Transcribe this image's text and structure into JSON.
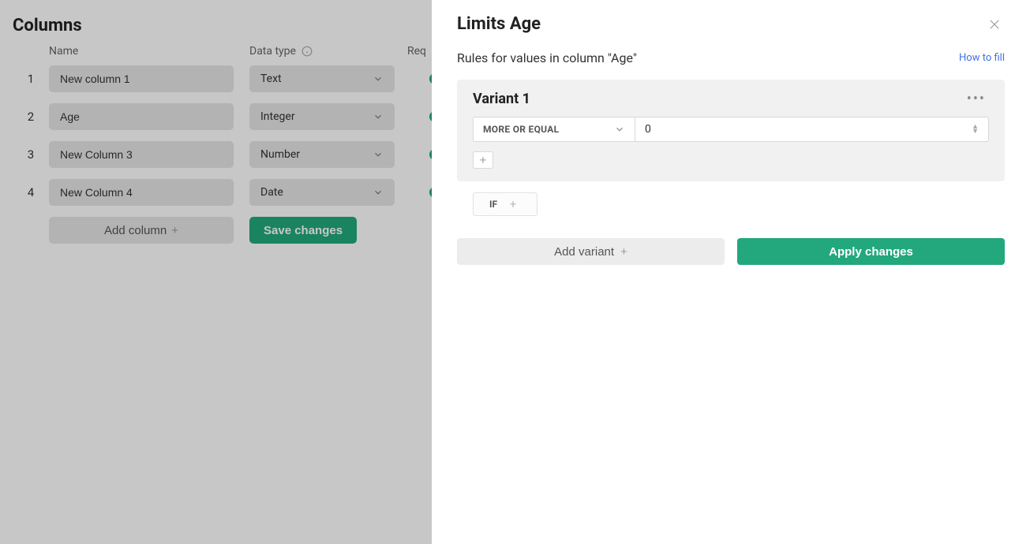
{
  "background": {
    "title": "Columns",
    "headers": {
      "name": "Name",
      "datatype": "Data type",
      "required": "Req"
    },
    "rows": [
      {
        "num": "1",
        "name": "New column 1",
        "type": "Text"
      },
      {
        "num": "2",
        "name": "Age",
        "type": "Integer"
      },
      {
        "num": "3",
        "name": "New Column 3",
        "type": "Number"
      },
      {
        "num": "4",
        "name": "New Column 4",
        "type": "Date"
      }
    ],
    "add_column_label": "Add column",
    "save_changes_label": "Save changes"
  },
  "drawer": {
    "title": "Limits Age",
    "subtitle": "Rules for values in column \"Age\"",
    "how_to_fill": "How to fill",
    "variant": {
      "title": "Variant 1",
      "operator": "MORE OR EQUAL",
      "value": "0",
      "if_label": "IF"
    },
    "add_variant_label": "Add variant",
    "apply_label": "Apply changes"
  }
}
